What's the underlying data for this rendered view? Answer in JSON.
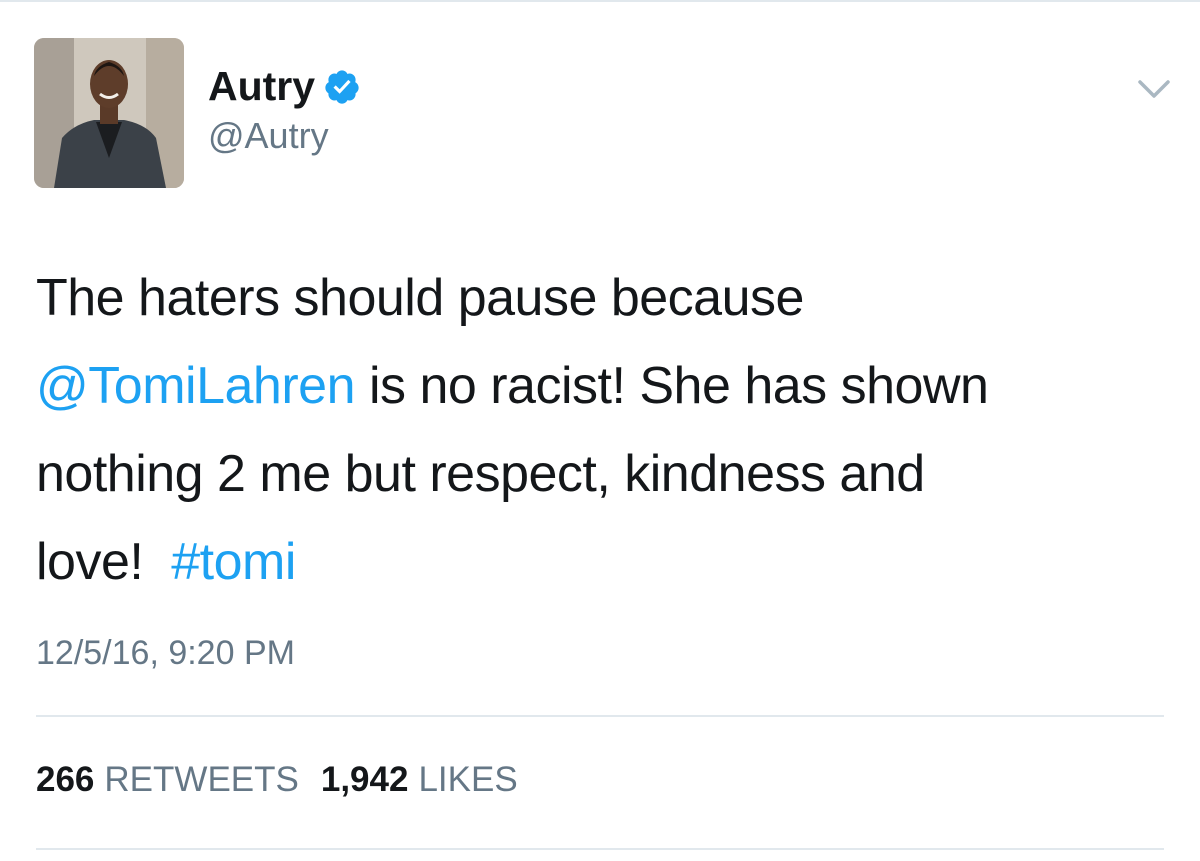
{
  "tweet": {
    "display_name": "Autry",
    "handle": "@Autry",
    "verified": true,
    "text_lines": [
      {
        "before": "The haters should pause because",
        "link": "",
        "after": ""
      },
      {
        "before": "",
        "link": "@TomiLahren",
        "after": " is no racist! She has shown"
      },
      {
        "before": "nothing 2 me but respect, kindness and",
        "link": "",
        "after": ""
      },
      {
        "before": "love!  ",
        "link": "#tomi",
        "after": ""
      }
    ],
    "timestamp": "12/5/16, 9:20 PM",
    "stats": {
      "retweets_count": "266",
      "retweets_label": "RETWEETS",
      "likes_count": "1,942",
      "likes_label": "LIKES"
    }
  },
  "icons": {
    "verified": "verified-badge-icon",
    "menu": "chevron-down-icon"
  },
  "colors": {
    "link": "#1da1f2",
    "secondary_text": "#657786",
    "primary_text": "#14171a",
    "divider": "#e1e8ed"
  }
}
